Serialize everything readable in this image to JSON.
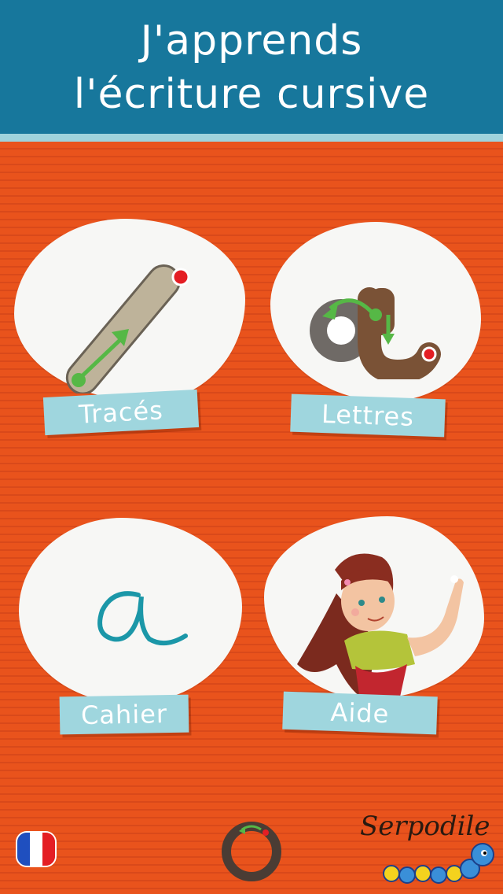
{
  "header": {
    "title_line1": "J'apprends",
    "title_line2": "l'écriture cursive"
  },
  "menu": {
    "traces": {
      "label": "Tracés",
      "icon": "trace-path-icon"
    },
    "lettres": {
      "label": "Lettres",
      "icon": "letter-a-trace-icon"
    },
    "cahier": {
      "label": "Cahier",
      "icon": "cursive-a-icon"
    },
    "aide": {
      "label": "Aide",
      "icon": "girl-writing-illustration"
    }
  },
  "footer": {
    "language_flag": "french-flag-icon",
    "home_icon": "circle-home-icon",
    "brand": "Serpodile"
  },
  "colors": {
    "header": "#17779c",
    "header_border": "#9fd3dc",
    "background": "#e8541e",
    "label": "#9fd6de",
    "card": "#f7f7f5"
  }
}
